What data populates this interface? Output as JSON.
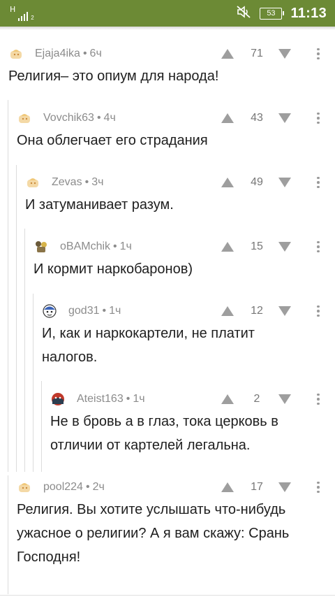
{
  "status_bar": {
    "network_type": "H",
    "signal_sub": "2",
    "battery_level": "53",
    "time": "11:13",
    "bg_color": "#6c8a35",
    "icons": [
      "signal-icon",
      "mute-icon",
      "battery-icon"
    ]
  },
  "comments": [
    {
      "author": "Ejaja4ika",
      "time_ago": "6ч",
      "rating": "71",
      "text": "Религия– это опиум для народа!",
      "depth": 0
    },
    {
      "author": "Vovchik63",
      "time_ago": "4ч",
      "rating": "43",
      "text": "Она облегчает его страдания",
      "depth": 1
    },
    {
      "author": "Zevas",
      "time_ago": "3ч",
      "rating": "49",
      "text": "И затуманивает разум.",
      "depth": 2
    },
    {
      "author": "oBAMchik",
      "time_ago": "1ч",
      "rating": "15",
      "text": "И кормит наркобаронов)",
      "depth": 3
    },
    {
      "author": "god31",
      "time_ago": "1ч",
      "rating": "12",
      "text_lines": [
        "И, как и наркокартели, не платит",
        "налогов."
      ],
      "depth": 4
    },
    {
      "author": "Ateist163",
      "time_ago": "1ч",
      "rating": "2",
      "text_lines": [
        "Не в бровь а в глаз, тока церковь в",
        "отличии от картелей легальна."
      ],
      "depth": 5
    },
    {
      "author": "pool224",
      "time_ago": "2ч",
      "rating": "17",
      "text_lines": [
        "Религия. Вы хотите услышать что-нибудь",
        "ужасное о религии? А я вам скажу: Срань",
        "Господня!"
      ],
      "depth": 1
    }
  ],
  "meta_separator": "•",
  "icon_names": [
    "upvote-arrow-icon",
    "downvote-arrow-icon",
    "more-vertical-icon",
    "avatar-icon"
  ],
  "colors": {
    "arrow": "#9e9e9e",
    "meta_text": "#8c8c8c",
    "thread_line": "#dcdcdc"
  }
}
